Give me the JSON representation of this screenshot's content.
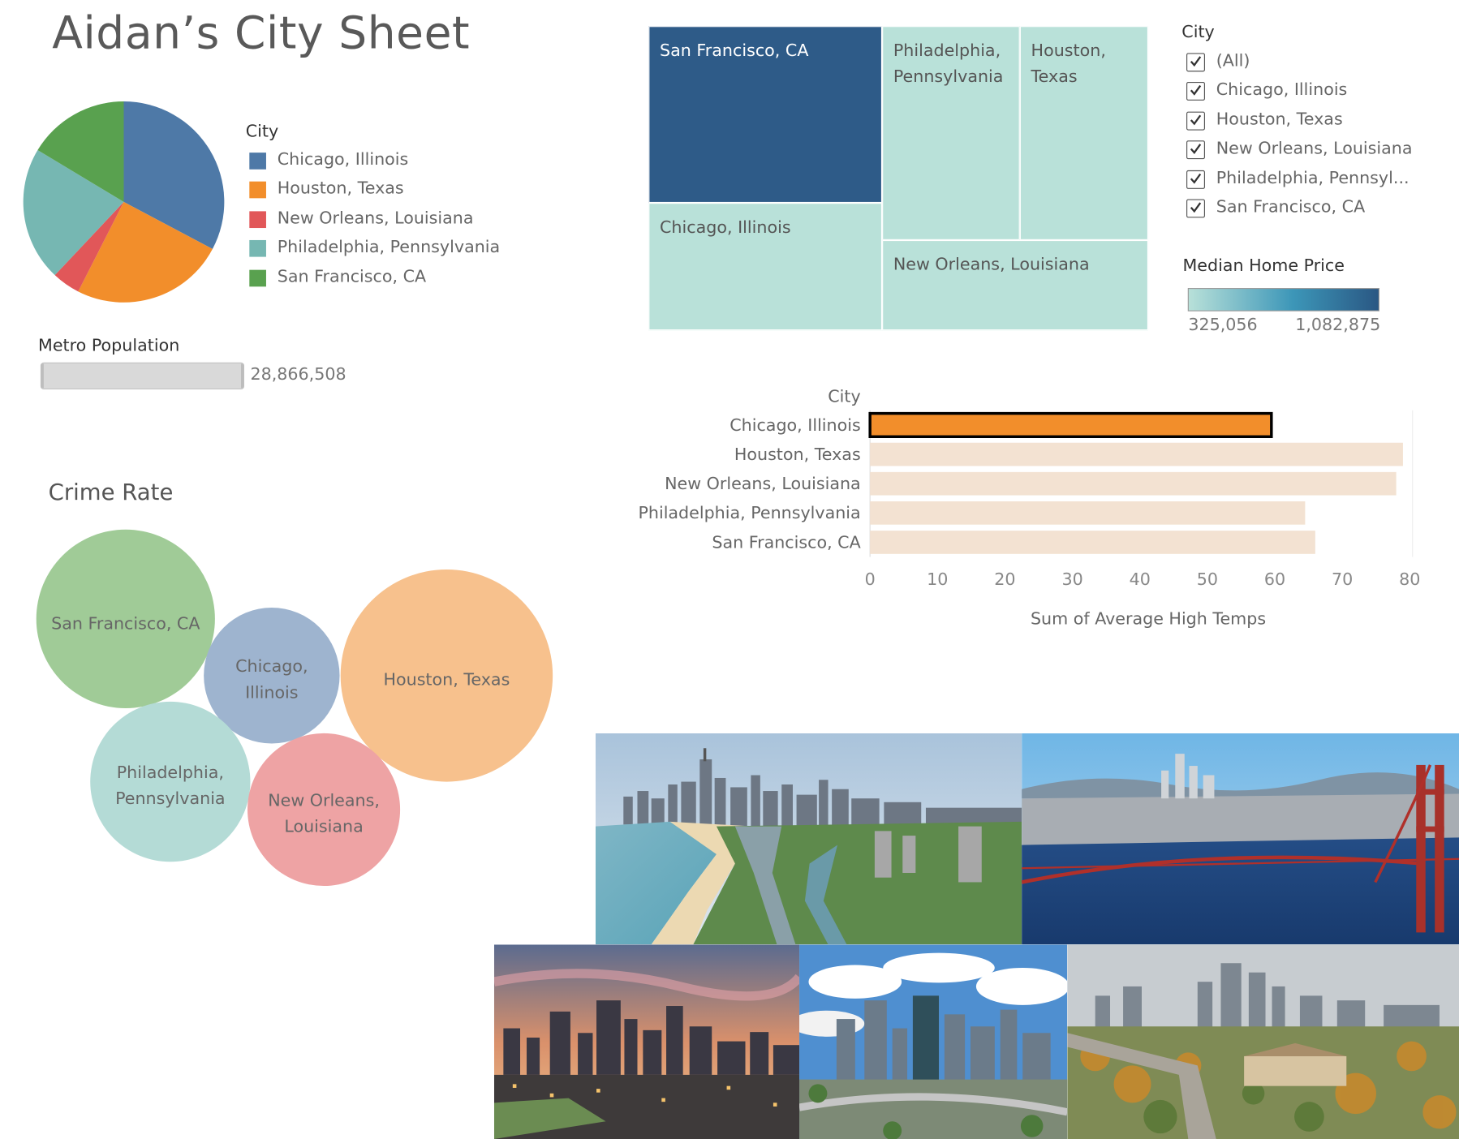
{
  "title": "Aidan’s City Sheet",
  "pie_legend": {
    "title": "City",
    "items": [
      {
        "label": "Chicago, Illinois",
        "color": "#4e79a7"
      },
      {
        "label": "Houston, Texas",
        "color": "#f28e2b"
      },
      {
        "label": "New Orleans, Louisiana",
        "color": "#e15759"
      },
      {
        "label": "Philadelphia, Pennsylvania",
        "color": "#76b7b2"
      },
      {
        "label": "San Francisco, CA",
        "color": "#59a14f"
      }
    ]
  },
  "metro_population": {
    "title": "Metro Population",
    "value_label": "28,866,508"
  },
  "crime_rate": {
    "title": "Crime Rate"
  },
  "filter": {
    "title": "City",
    "items": [
      {
        "label": "(All)",
        "checked": true
      },
      {
        "label": "Chicago, Illinois",
        "checked": true
      },
      {
        "label": "Houston, Texas",
        "checked": true
      },
      {
        "label": "New Orleans, Louisiana",
        "checked": true
      },
      {
        "label": "Philadelphia, Pennsyl...",
        "checked": true
      },
      {
        "label": "San Francisco, CA",
        "checked": true
      }
    ]
  },
  "median_home_price_legend": {
    "title": "Median Home Price",
    "min_label": "325,056",
    "max_label": "1,082,875",
    "color_low": "#b9e1d9",
    "color_high": "#2a5783"
  },
  "chart_data": [
    {
      "type": "pie",
      "measure": "Metro Population",
      "categories": [
        "Chicago, Illinois",
        "Houston, Texas",
        "New Orleans, Louisiana",
        "Philadelphia, Pennsylvania",
        "San Francisco, CA"
      ],
      "values": [
        9.4,
        7.1,
        1.3,
        6.2,
        4.7
      ],
      "colors": [
        "#4e79a7",
        "#f28e2b",
        "#e15759",
        "#76b7b2",
        "#59a14f"
      ],
      "legend_position": "right",
      "total_label": "28,866,508"
    },
    {
      "type": "treemap",
      "measure": "Median Home Price",
      "categories": [
        "San Francisco, CA",
        "Chicago, Illinois",
        "Philadelphia, Pennsylvania",
        "Houston, Texas",
        "New Orleans, Louisiana"
      ],
      "labels": [
        "San Francisco, CA",
        "Chicago, Illinois",
        "Philadelphia, Pennsylvania",
        "Houston, Texas",
        "New Orleans, Louisiana"
      ],
      "colors": [
        "#2e5b88",
        "#b9e1d9",
        "#b9e1d9",
        "#b9e1d9",
        "#b9e1d9"
      ],
      "color_range": [
        325056,
        1082875
      ]
    },
    {
      "type": "bar",
      "orientation": "horizontal",
      "title": "City",
      "categories": [
        "Chicago, Illinois",
        "Houston, Texas",
        "New Orleans, Louisiana",
        "Philadelphia, Pennsylvania",
        "San Francisco, CA"
      ],
      "values": [
        59.5,
        79,
        78,
        64.5,
        66
      ],
      "highlighted": "Chicago, Illinois",
      "highlight_color": "#f28e2b",
      "muted_color": "#f3e2d2",
      "xlabel": "Sum of Average High Temps",
      "xlim": [
        0,
        80
      ],
      "xticks": [
        "0",
        "10",
        "20",
        "30",
        "40",
        "50",
        "60",
        "70",
        "80"
      ],
      "grid": false
    },
    {
      "type": "bubble",
      "title": "Crime Rate",
      "bubbles": [
        {
          "label": "San Francisco, CA",
          "color": "#a0cb97",
          "relative_size": 0.84
        },
        {
          "label": "Chicago, Illinois",
          "color": "#9eb4cf",
          "relative_size": 0.63
        },
        {
          "label": "Houston, Texas",
          "color": "#f7c18d",
          "relative_size": 1.0
        },
        {
          "label": "Philadelphia, Pennsylvania",
          "color": "#b4dbd6",
          "relative_size": 0.75
        },
        {
          "label": "New Orleans, Louisiana",
          "color": "#eea3a4",
          "relative_size": 0.72
        }
      ]
    }
  ],
  "photos": [
    {
      "name": "chicago-photo"
    },
    {
      "name": "san-francisco-photo"
    },
    {
      "name": "new-orleans-photo"
    },
    {
      "name": "houston-photo"
    },
    {
      "name": "philadelphia-photo"
    }
  ]
}
